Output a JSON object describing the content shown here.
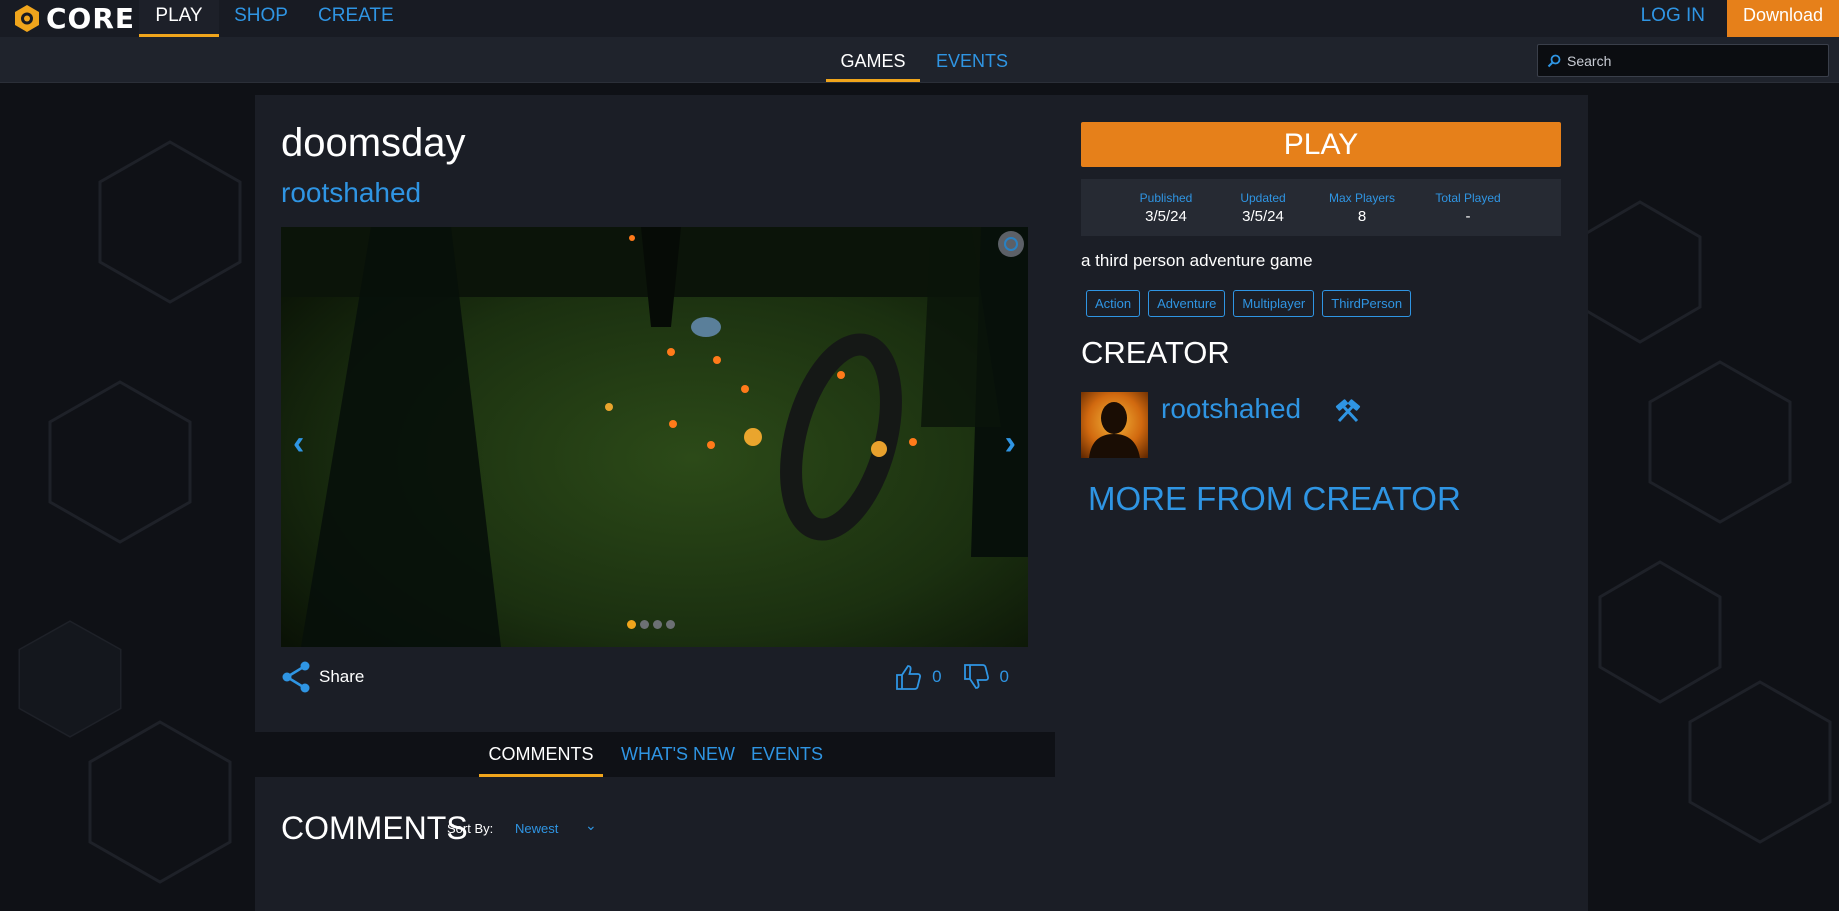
{
  "topnav": {
    "logo_text": "CORE",
    "tabs": [
      {
        "label": "PLAY",
        "active": true
      },
      {
        "label": "SHOP",
        "active": false
      },
      {
        "label": "CREATE",
        "active": false
      }
    ],
    "login_label": "LOG IN",
    "download_label": "Download"
  },
  "subnav": {
    "tabs": [
      {
        "label": "GAMES",
        "active": true
      },
      {
        "label": "EVENTS",
        "active": false
      }
    ],
    "search_placeholder": "Search"
  },
  "game": {
    "title": "doomsday",
    "creator": "rootshahed",
    "carousel": {
      "slides": 4,
      "active_index": 0
    },
    "share_label": "Share",
    "likes": "0",
    "dislikes": "0"
  },
  "bottom_tabs": [
    {
      "label": "COMMENTS",
      "active": true
    },
    {
      "label": "WHAT'S NEW",
      "active": false
    },
    {
      "label": "EVENTS",
      "active": false
    }
  ],
  "comments": {
    "title": "COMMENTS",
    "sort_label": "Sort By:",
    "sort_value": "Newest"
  },
  "sidebar": {
    "play_label": "PLAY",
    "stats": [
      {
        "label": "Published",
        "value": "3/5/24"
      },
      {
        "label": "Updated",
        "value": "3/5/24"
      },
      {
        "label": "Max Players",
        "value": "8"
      },
      {
        "label": "Total Played",
        "value": "-"
      }
    ],
    "description": "a third person adventure game",
    "tags": [
      "Action",
      "Adventure",
      "Multiplayer",
      "ThirdPerson"
    ],
    "creator_heading": "CREATOR",
    "creator_name": "rootshahed",
    "more_from_creator": "MORE FROM CREATOR"
  },
  "colors": {
    "accent_orange": "#e6801a",
    "link_blue": "#2f95e3",
    "tab_underline": "#f0a51c",
    "panel": "#1b1e26",
    "background": "#0f1116"
  },
  "icons": [
    "core-logo-icon",
    "search-icon",
    "chevron-left-icon",
    "chevron-right-icon",
    "expand-icon",
    "share-icon",
    "thumbs-up-icon",
    "thumbs-down-icon",
    "chevron-down-icon",
    "creator-badge-icon"
  ]
}
